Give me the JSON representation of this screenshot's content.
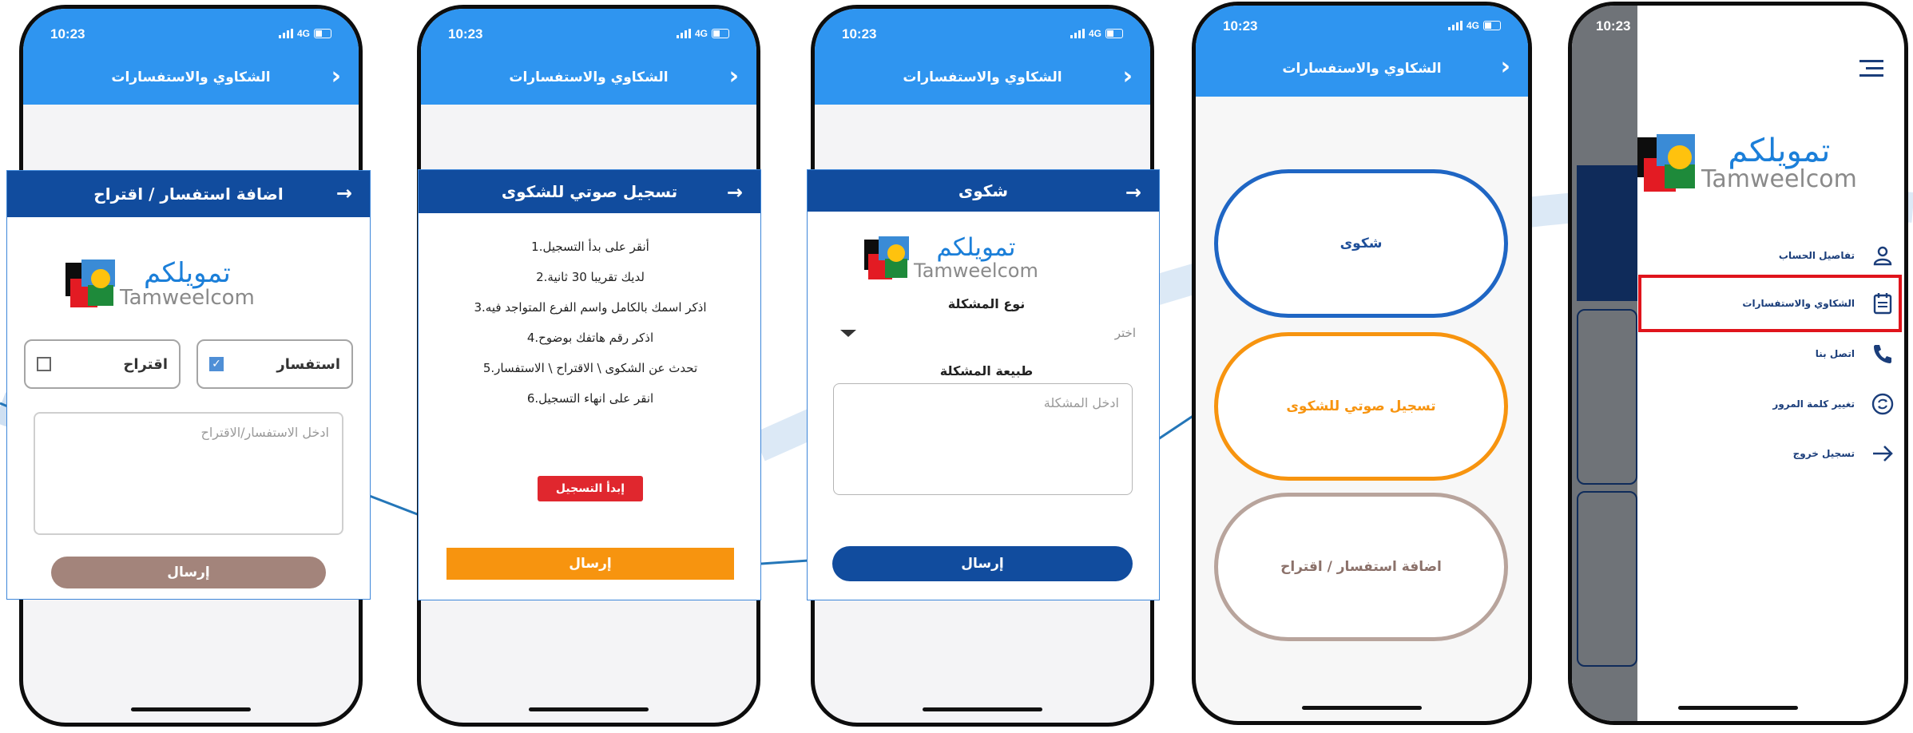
{
  "status": {
    "time": "10:23",
    "network": "4G"
  },
  "header_title": "الشكاوي والاستفسارات",
  "inquiry_form": {
    "title": "اضافة استفسار / اقتراح",
    "option_inquiry": "استفسار",
    "option_suggestion": "اقتراح",
    "textarea_placeholder": "ادخل الاستفسار/الاقتراح",
    "send_label": "إرسال"
  },
  "voice_form": {
    "title": "تسجيل صوتي للشكوى",
    "steps": [
      "1.أنقر على بدأ التسجيل",
      "2.لديك تقريبا 30 ثانية",
      "3.اذكر اسمك بالكامل واسم الفرع المتواجد فيه",
      "4.اذكر رقم هاتفك بوضوح",
      "5.تحدث عن الشكوى \\ الاقتراح \\ الاستفسار",
      "6.انقر على انهاء التسجيل"
    ],
    "record_label": "إبدأ التسجيل",
    "send_label": "إرسال"
  },
  "complaint_form": {
    "title": "شكوى",
    "problem_type_label": "نوع المشكلة",
    "select_placeholder": "اختر",
    "problem_nature_label": "طبيعة المشكلة",
    "textarea_placeholder": "ادخل المشكلة",
    "send_label": "إرسال"
  },
  "options_screen": {
    "complaint": "شكوى",
    "voice_complaint": "تسجيل صوتي للشكوى",
    "inquiry_suggestion": "اضافة استفسار / اقتراح"
  },
  "logo": {
    "arabic": "تمويلكم",
    "english": "Tamweelcom"
  },
  "menu": {
    "items": [
      {
        "label": "تفاصيل الحساب",
        "icon": "person-icon"
      },
      {
        "label": "الشكاوي والاستفسارات",
        "icon": "clipboard-icon",
        "highlighted": true
      },
      {
        "label": "اتصل بنا",
        "icon": "phone-icon"
      },
      {
        "label": "تغيير كلمة المرور",
        "icon": "refresh-icon"
      },
      {
        "label": "تسجيل خروج",
        "icon": "logout-arrow-icon"
      }
    ]
  },
  "colors": {
    "app_blue": "#2f95f0",
    "dark_blue": "#114c9e",
    "orange": "#f7940f",
    "taupe": "#b8a49c",
    "highlight_red": "#e0141c"
  }
}
